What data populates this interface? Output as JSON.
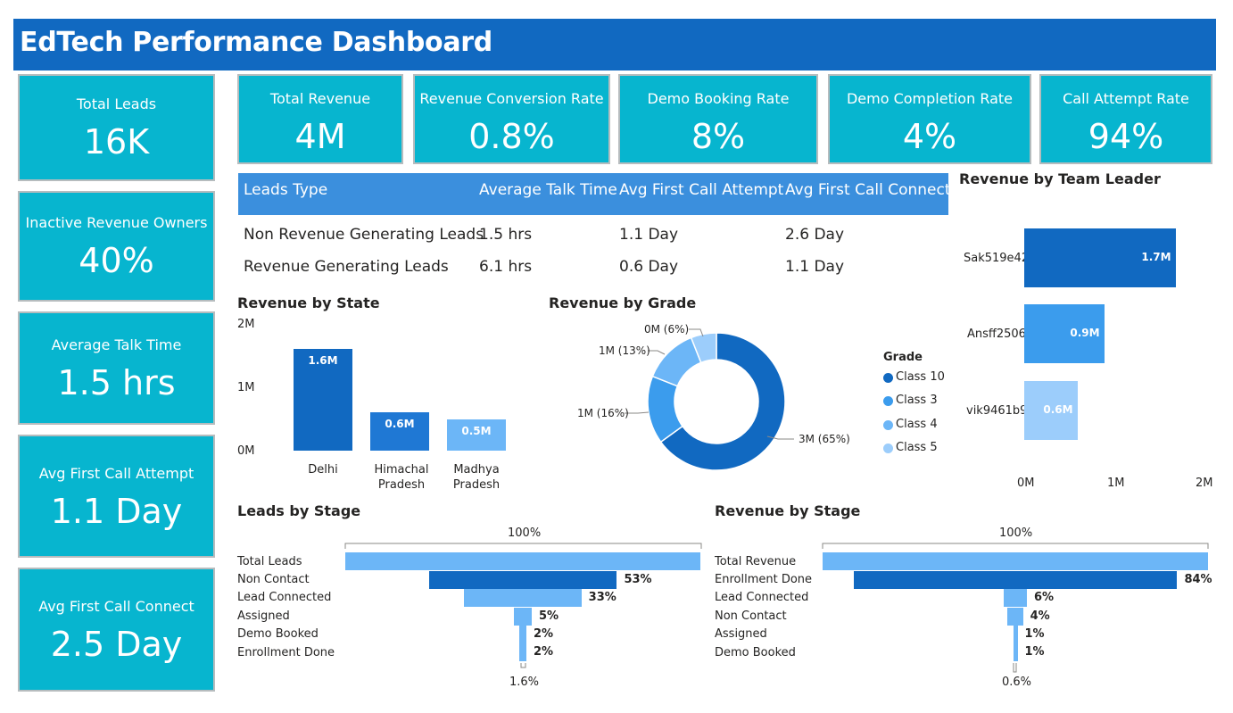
{
  "header": {
    "title": "EdTech Performance Dashboard"
  },
  "side_cards": [
    {
      "label": "Total Leads",
      "value": "16K"
    },
    {
      "label": "Inactive Revenue Owners",
      "value": "40%"
    },
    {
      "label": "Average Talk Time",
      "value": "1.5 hrs"
    },
    {
      "label": "Avg First Call Attempt",
      "value": "1.1 Day"
    },
    {
      "label": "Avg First Call Connect",
      "value": "2.5 Day"
    }
  ],
  "top_cards": [
    {
      "label": "Total Revenue",
      "value": "4M"
    },
    {
      "label": "Revenue Conversion Rate",
      "value": "0.8%"
    },
    {
      "label": "Demo Booking Rate",
      "value": "8%"
    },
    {
      "label": "Demo Completion Rate",
      "value": "4%"
    },
    {
      "label": "Call Attempt Rate",
      "value": "94%"
    }
  ],
  "leads_table": {
    "columns": [
      "Leads Type",
      "Average Talk Time",
      "Avg First Call Attempt",
      "Avg First Call Connect"
    ],
    "rows": [
      [
        "Non Revenue Generating Leads",
        "1.5 hrs",
        "1.1 Day",
        "2.6 Day"
      ],
      [
        "Revenue Generating Leads",
        "6.1 hrs",
        "0.6 Day",
        "1.1 Day"
      ]
    ]
  },
  "colors": {
    "header": "#1169c1",
    "card": "#07b5cf",
    "table_header": "#3b8fdd",
    "dark_blue": "#1169c1",
    "mid_blue": "#3b9ced",
    "light_blue": "#6cb6f7",
    "pale_blue": "#9ccdfb"
  },
  "chart_data": [
    {
      "type": "bar",
      "title": "Revenue by State",
      "categories": [
        "Delhi",
        "Himachal Pradesh",
        "Madhya Pradesh"
      ],
      "values": [
        1.6,
        0.6,
        0.5
      ],
      "value_labels": [
        "1.6M",
        "0.6M",
        "0.5M"
      ],
      "ylim": [
        0,
        2
      ],
      "yticks": [
        "0M",
        "1M",
        "2M"
      ]
    },
    {
      "type": "pie",
      "title": "Revenue by Grade",
      "legend_title": "Grade",
      "legend_position": "right",
      "categories": [
        "Class 10",
        "Class 3",
        "Class 4",
        "Class 5"
      ],
      "values": [
        65,
        16,
        13,
        6
      ],
      "slice_labels": [
        "3M (65%)",
        "1M (16%)",
        "1M (13%)",
        "0M (6%)"
      ]
    },
    {
      "type": "bar",
      "orientation": "horizontal",
      "title": "Revenue by Team Leader",
      "categories": [
        "Sak519e42",
        "Ansff2506",
        "vik9461b9"
      ],
      "values": [
        1.7,
        0.9,
        0.6
      ],
      "value_labels": [
        "1.7M",
        "0.9M",
        "0.6M"
      ],
      "xlim": [
        0,
        2
      ],
      "xticks": [
        "0M",
        "1M",
        "2M"
      ]
    },
    {
      "type": "bar",
      "subtype": "funnel",
      "title": "Leads by Stage",
      "categories": [
        "Total Leads",
        "Non Contact",
        "Lead Connected",
        "Assigned",
        "Demo Booked",
        "Enrollment Done"
      ],
      "values": [
        100,
        53,
        33,
        5,
        2,
        2
      ],
      "value_labels": [
        "",
        "53%",
        "33%",
        "5%",
        "2%",
        "2%"
      ],
      "top_label": "100%",
      "bottom_label": "1.6%"
    },
    {
      "type": "bar",
      "subtype": "funnel",
      "title": "Revenue by Stage",
      "categories": [
        "Total Revenue",
        "Enrollment Done",
        "Lead Connected",
        "Non Contact",
        "Assigned",
        "Demo Booked"
      ],
      "values": [
        100,
        84,
        6,
        4,
        1,
        1
      ],
      "value_labels": [
        "",
        "84%",
        "6%",
        "4%",
        "1%",
        "1%"
      ],
      "top_label": "100%",
      "bottom_label": "0.6%"
    }
  ]
}
